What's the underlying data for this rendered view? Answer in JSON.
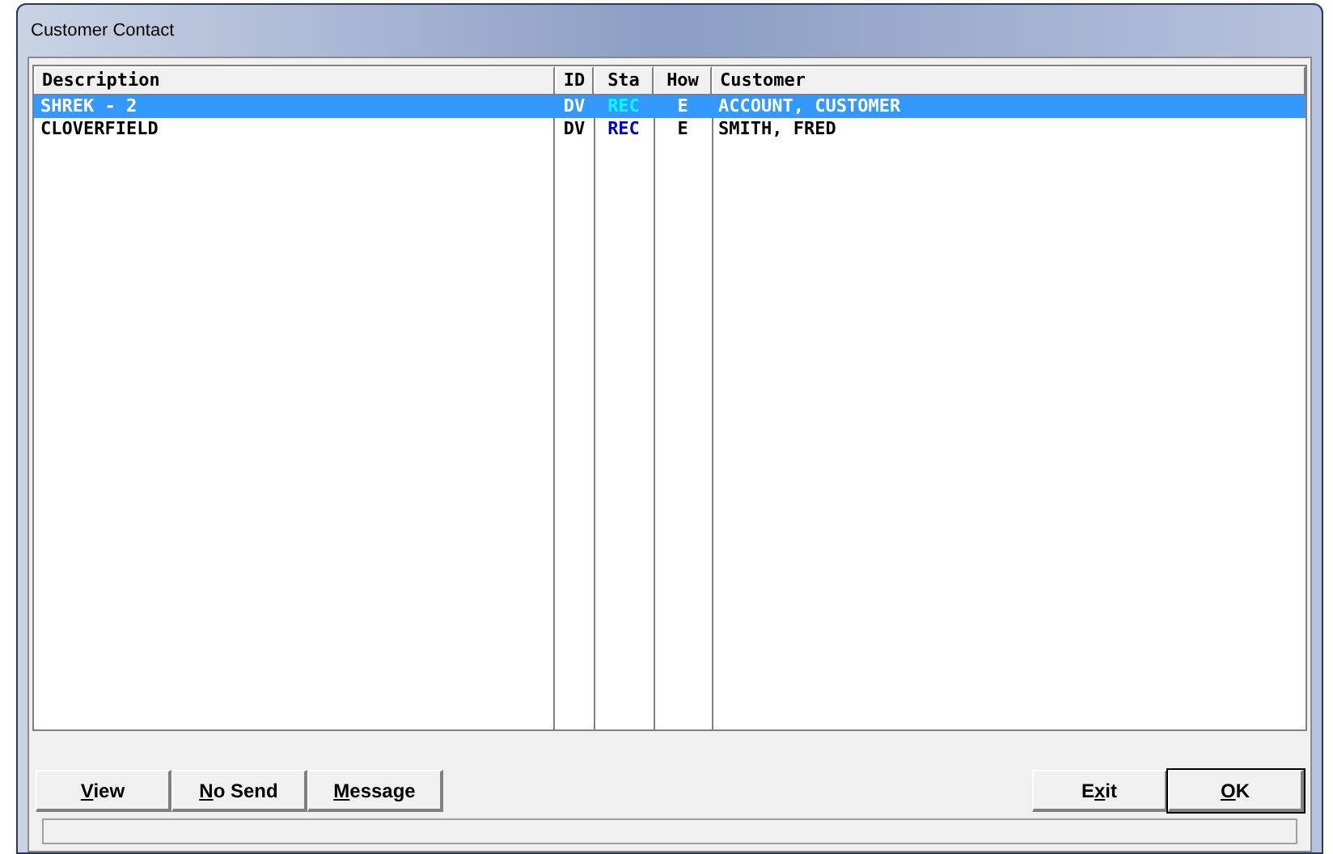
{
  "window": {
    "title": "Customer Contact"
  },
  "table": {
    "columns": [
      "Description",
      "ID",
      "Sta",
      "How",
      "Customer"
    ],
    "rows": [
      {
        "cells": [
          "SHREK - 2",
          "DV",
          "REC",
          "E",
          "ACCOUNT, CUSTOMER"
        ],
        "selected": true,
        "color": "#00ffff"
      },
      {
        "cells": [
          "CLOVERFIELD",
          "DV",
          "REC",
          "E",
          "SMITH, FRED"
        ],
        "selected": false,
        "color": "#0000cc"
      }
    ]
  },
  "buttons_left": [
    {
      "key": "V",
      "after": "iew"
    },
    {
      "key": "N",
      "after": "o Send"
    },
    {
      "key": "M",
      "after": "essage"
    }
  ],
  "buttons_right": [
    {
      "before": "E",
      "key": "x",
      "after": "it",
      "default": false
    },
    {
      "key": "O",
      "after": "K",
      "default": true
    }
  ]
}
